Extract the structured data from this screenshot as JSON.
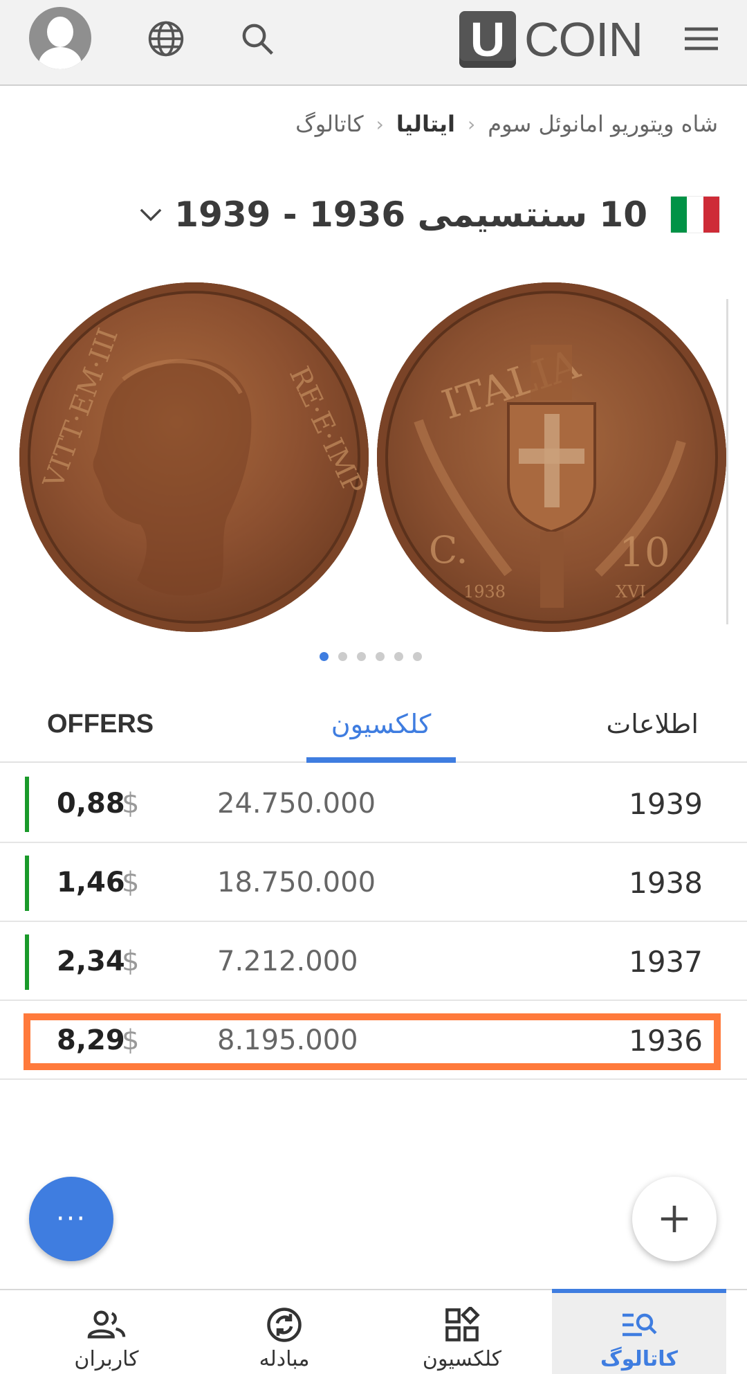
{
  "header": {
    "logo_letter": "U",
    "logo_text": "COIN",
    "icons": [
      "profile-avatar",
      "globe-icon",
      "search-icon",
      "menu-icon"
    ]
  },
  "breadcrumb": {
    "items": [
      {
        "label": "کاتالوگ"
      },
      {
        "label": "ایتالیا"
      },
      {
        "label": "شاه ویتوریو امانوئل سوم"
      }
    ]
  },
  "coin": {
    "title": "10 سنتسیمی 1936 - 1939",
    "flag_colors": [
      "#009246",
      "#ffffff",
      "#ce2b37"
    ],
    "images": [
      "obverse",
      "reverse"
    ],
    "carousel": {
      "count": 6,
      "active": 0
    }
  },
  "tabs": {
    "offers": "OFFERS",
    "collection": "کلکسیون",
    "info": "اطلاعات"
  },
  "rows": [
    {
      "price": "0,88",
      "currency": "$",
      "mintage": "24.750.000",
      "year": "1939"
    },
    {
      "price": "1,46",
      "currency": "$",
      "mintage": "18.750.000",
      "year": "1938"
    },
    {
      "price": "2,34",
      "currency": "$",
      "mintage": "7.212.000",
      "year": "1937"
    },
    {
      "price": "8,29",
      "currency": "$",
      "mintage": "8.195.000",
      "year": "1936"
    }
  ],
  "fab": {
    "more_label": "···"
  },
  "bottom_nav": {
    "items": [
      {
        "label": "کاربران",
        "icon": "users-icon"
      },
      {
        "label": "مبادله",
        "icon": "exchange-icon"
      },
      {
        "label": "کلکسیون",
        "icon": "collection-icon"
      },
      {
        "label": "کاتالوگ",
        "icon": "catalog-icon"
      }
    ],
    "active": 3
  },
  "colors": {
    "accent": "#3f7de0",
    "highlight": "#ff7a3c",
    "status_green": "#1a9a2a"
  }
}
